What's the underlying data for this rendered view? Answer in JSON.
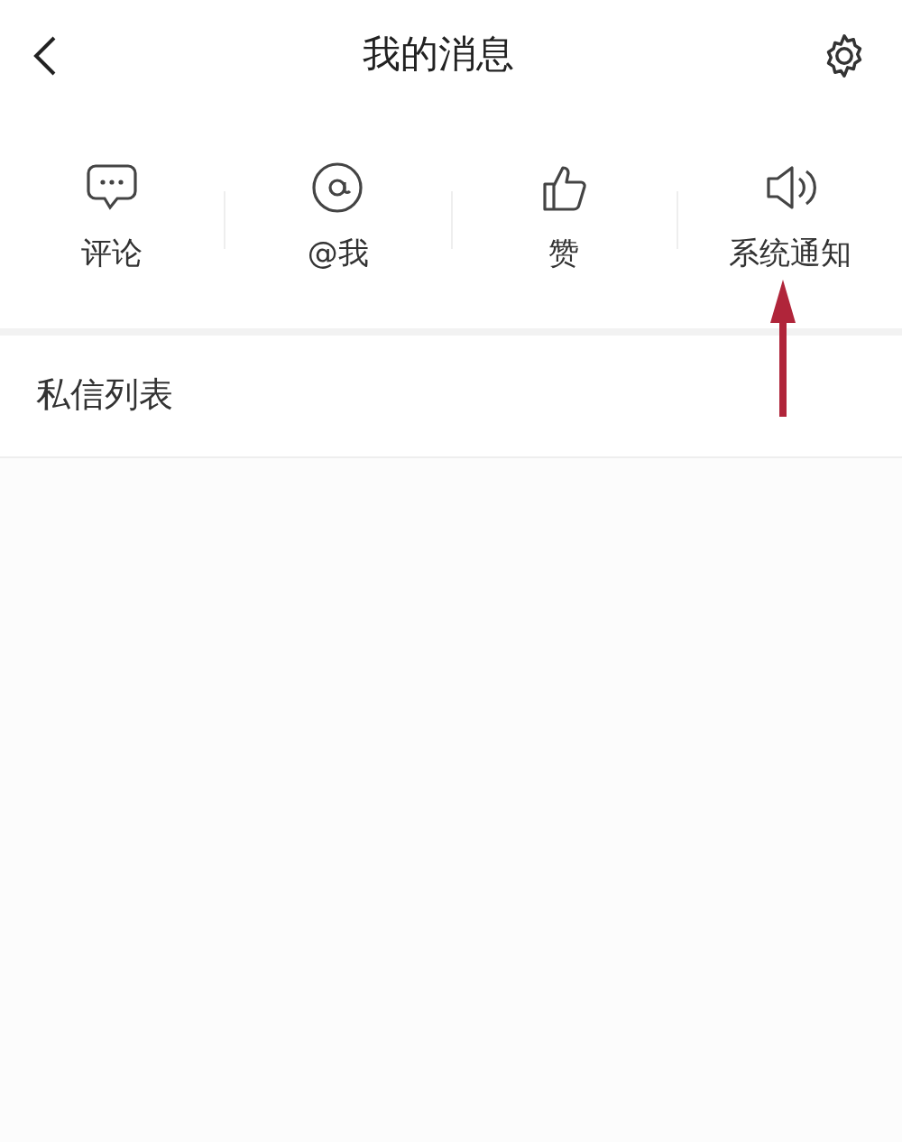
{
  "header": {
    "title": "我的消息"
  },
  "categories": [
    {
      "kind": "comment",
      "label": "评论"
    },
    {
      "kind": "mention",
      "label": "@我"
    },
    {
      "kind": "like",
      "label": "赞"
    },
    {
      "kind": "notice",
      "label": "系统通知"
    }
  ],
  "sections": [
    {
      "label": "私信列表"
    }
  ]
}
